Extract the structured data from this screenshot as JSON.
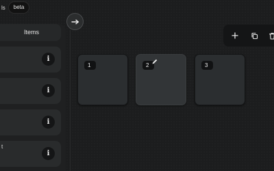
{
  "topbar": {
    "cut_text": "ls",
    "badge": "beta"
  },
  "sidebar": {
    "header": "Items",
    "items": [
      {
        "label": "",
        "info_icon": "info-icon"
      },
      {
        "label": "",
        "info_icon": "info-icon"
      },
      {
        "label": "",
        "info_icon": "info-icon"
      },
      {
        "label": "t",
        "info_icon": "info-icon"
      }
    ]
  },
  "toggle": {
    "icon": "arrow-right-icon"
  },
  "toolbar": {
    "tools": [
      {
        "icon": "plus-icon"
      },
      {
        "icon": "copy-icon"
      },
      {
        "icon": "trash-icon"
      }
    ]
  },
  "cards": [
    {
      "number": "1",
      "active": false
    },
    {
      "number": "2",
      "active": true
    },
    {
      "number": "3",
      "active": false
    }
  ],
  "colors": {
    "background": "#1c1d1e",
    "panel": "#1f2021",
    "item": "#292b2c",
    "card": "#2b2e30",
    "dark_chip": "#111213"
  }
}
